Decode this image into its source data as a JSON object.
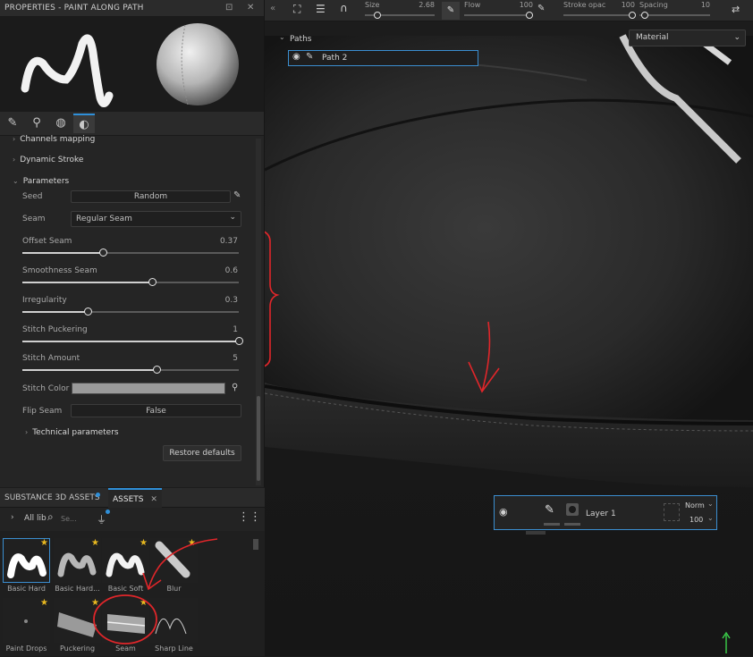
{
  "properties": {
    "title": "PROPERTIES - PAINT ALONG PATH",
    "tabs": [
      "brush-tab",
      "eyedropper-tab",
      "material-tab",
      "stroke-tab"
    ],
    "sections": {
      "channels_mapping": "Channels mapping",
      "dynamic_stroke": "Dynamic Stroke",
      "parameters": "Parameters",
      "technical": "Technical parameters"
    },
    "seed": {
      "label": "Seed",
      "value": "Random"
    },
    "seam": {
      "label": "Seam",
      "value": "Regular Seam"
    },
    "offset_seam": {
      "label": "Offset Seam",
      "value": "0.37",
      "fraction": 0.37
    },
    "smoothness_seam": {
      "label": "Smoothness Seam",
      "value": "0.6",
      "fraction": 0.6
    },
    "irregularity": {
      "label": "Irregularity",
      "value": "0.3",
      "fraction": 0.3
    },
    "stitch_puckering": {
      "label": "Stitch Puckering",
      "value": "1",
      "fraction": 1.0
    },
    "stitch_amount": {
      "label": "Stitch Amount",
      "value": "5",
      "fraction": 0.62
    },
    "stitch_color": {
      "label": "Stitch Color",
      "color": "#9a9a9a"
    },
    "flip_seam": {
      "label": "Flip Seam",
      "value": "False"
    },
    "restore": "Restore defaults"
  },
  "assets": {
    "tabs": [
      "SUBSTANCE 3D ASSETS",
      "ASSETS"
    ],
    "location": "All lib",
    "search_placeholder": "Se...",
    "items": [
      {
        "label": "Basic Hard",
        "starred": true,
        "selected": true
      },
      {
        "label": "Basic Hard...",
        "starred": true,
        "selected": false
      },
      {
        "label": "Basic Soft",
        "starred": true,
        "selected": false
      },
      {
        "label": "Blur",
        "starred": true,
        "selected": false
      },
      {
        "label": "Paint Drops",
        "starred": true,
        "selected": false
      },
      {
        "label": "Puckering",
        "starred": true,
        "selected": false
      },
      {
        "label": "Seam",
        "starred": true,
        "selected": false
      },
      {
        "label": "Sharp Line",
        "starred": false,
        "selected": false
      }
    ]
  },
  "toolbar": {
    "size": {
      "label": "Size",
      "value": "2.68"
    },
    "flow": {
      "label": "Flow",
      "value": "100"
    },
    "stroke_opacity": {
      "label": "Stroke opac",
      "value": "100"
    },
    "spacing": {
      "label": "Spacing",
      "value": "10"
    }
  },
  "viewport": {
    "paths_title": "Paths",
    "path_item": "Path 2",
    "material_mode": "Material"
  },
  "layers": {
    "name": "Layer 1",
    "blend": "Norm",
    "opacity": "100"
  },
  "annotation_color": "#e0262a",
  "accent_color": "#2f8fd8"
}
